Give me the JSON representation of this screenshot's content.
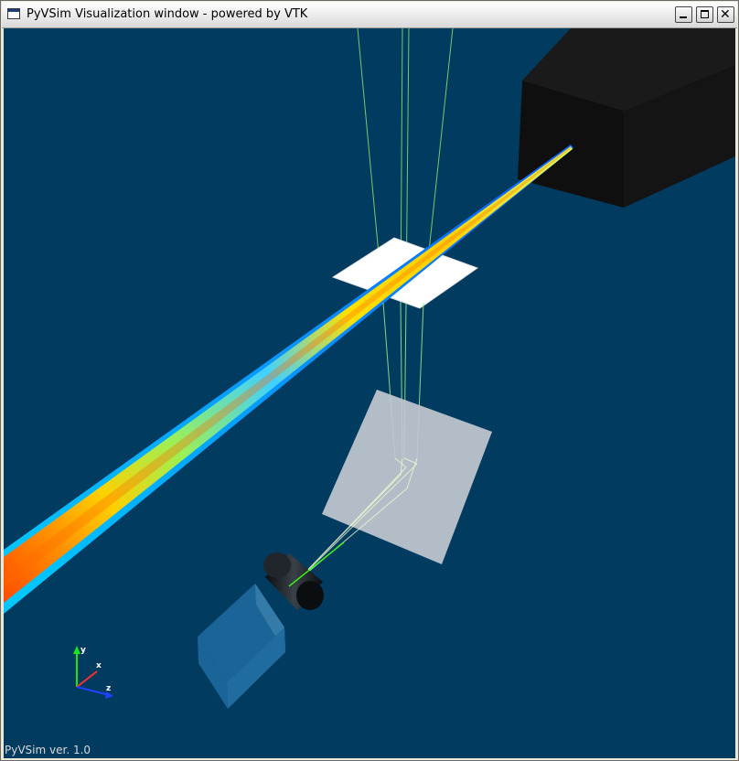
{
  "window": {
    "title": "PyVSim Visualization window - powered by VTK",
    "controls": {
      "minimize": "minimize",
      "maximize": "maximize",
      "close": "✕"
    }
  },
  "viewport": {
    "background_color": "#013b60",
    "version_label": "PyVSim ver. 1.0"
  },
  "axes": {
    "y": "y",
    "x": "x",
    "z": "z"
  },
  "colors": {
    "ray": "#8fe67a",
    "laser_box": "#121212",
    "mirror": "#c2c9d0",
    "target": "#ffffff",
    "camera_body": "#2e7fb8",
    "lens": "#14181c"
  },
  "scene_objects": [
    "laser-source-box",
    "laser-sheet-beam",
    "calibration-plate",
    "mirror-plane",
    "camera-lens",
    "camera-body",
    "light-rays"
  ]
}
